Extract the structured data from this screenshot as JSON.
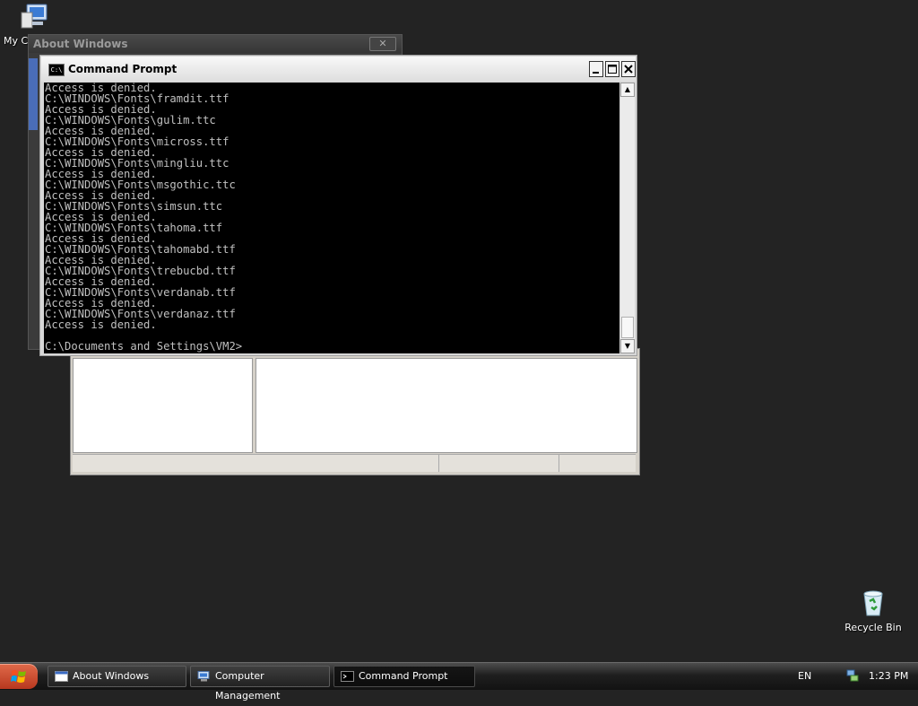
{
  "desktop": {
    "icons": {
      "my_computer": "My C",
      "recycle_bin": "Recycle Bin"
    }
  },
  "about_window": {
    "title": "About Windows"
  },
  "cmd": {
    "title": "Command Prompt",
    "icon_text": "C:\\",
    "lines": [
      "Access is denied.",
      "C:\\WINDOWS\\Fonts\\framdit.ttf",
      "Access is denied.",
      "C:\\WINDOWS\\Fonts\\gulim.ttc",
      "Access is denied.",
      "C:\\WINDOWS\\Fonts\\micross.ttf",
      "Access is denied.",
      "C:\\WINDOWS\\Fonts\\mingliu.ttc",
      "Access is denied.",
      "C:\\WINDOWS\\Fonts\\msgothic.ttc",
      "Access is denied.",
      "C:\\WINDOWS\\Fonts\\simsun.ttc",
      "Access is denied.",
      "C:\\WINDOWS\\Fonts\\tahoma.ttf",
      "Access is denied.",
      "C:\\WINDOWS\\Fonts\\tahomabd.ttf",
      "Access is denied.",
      "C:\\WINDOWS\\Fonts\\trebucbd.ttf",
      "Access is denied.",
      "C:\\WINDOWS\\Fonts\\verdanab.ttf",
      "Access is denied.",
      "C:\\WINDOWS\\Fonts\\verdanaz.ttf",
      "Access is denied.",
      "",
      "C:\\Documents and Settings\\VM2>"
    ]
  },
  "taskbar": {
    "tasks": [
      {
        "label": "About Windows",
        "icon": "window-icon"
      },
      {
        "label": "Computer Management",
        "icon": "computer-management-icon"
      },
      {
        "label": "Command Prompt",
        "icon": "command-prompt-icon"
      }
    ],
    "language": "EN",
    "clock": "1:23 PM"
  },
  "colors": {
    "desktop": "#232323",
    "console_bg": "#000000",
    "console_text": "#c0c0c0",
    "start_button": "#c94a2c"
  }
}
